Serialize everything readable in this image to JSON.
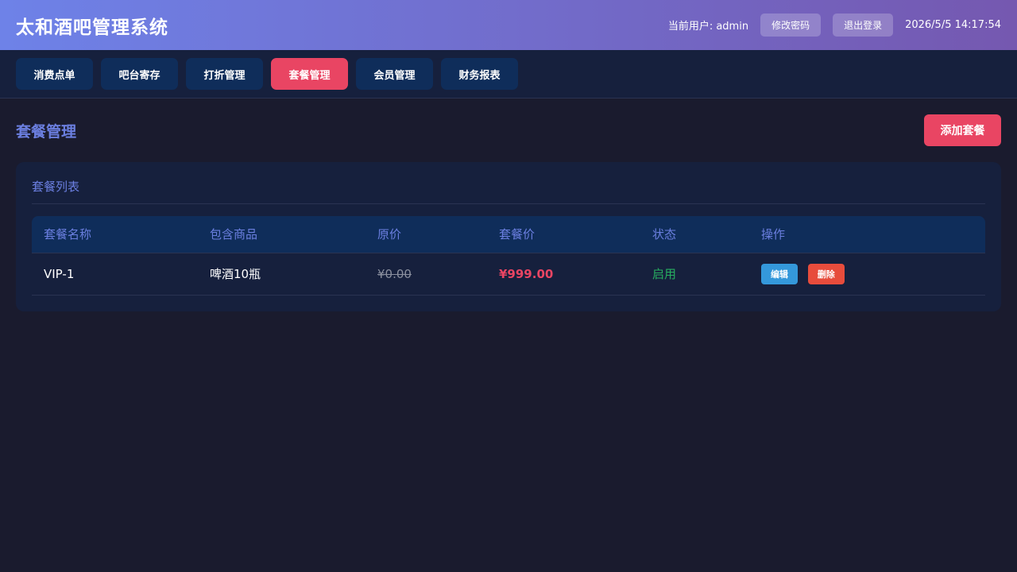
{
  "header": {
    "title": "太和酒吧管理系统",
    "current_user": "当前用户: admin",
    "change_password": "修改密码",
    "logout": "退出登录",
    "datetime": "2026/5/5 14:17:54"
  },
  "nav": {
    "tabs": [
      {
        "label": "消费点单"
      },
      {
        "label": "吧台寄存"
      },
      {
        "label": "打折管理"
      },
      {
        "label": "套餐管理",
        "active": true
      },
      {
        "label": "会员管理"
      },
      {
        "label": "财务报表"
      }
    ]
  },
  "page": {
    "title": "套餐管理",
    "add_button": "添加套餐"
  },
  "card": {
    "title": "套餐列表"
  },
  "table": {
    "columns": [
      "套餐名称",
      "包含商品",
      "原价",
      "套餐价",
      "状态",
      "操作"
    ],
    "rows": [
      {
        "name": "VIP-1",
        "items": "啤酒10瓶",
        "original_price": "¥0.00",
        "package_price": "¥999.00",
        "status": "启用",
        "edit": "编辑",
        "delete": "删除"
      }
    ]
  },
  "colors": {
    "accent": "#e94563",
    "header_gradient_start": "#6e82e8",
    "header_gradient_end": "#7558b0",
    "title_blue": "#6b7fe0",
    "background": "#1a1b2e",
    "status_green": "#27ae60"
  }
}
